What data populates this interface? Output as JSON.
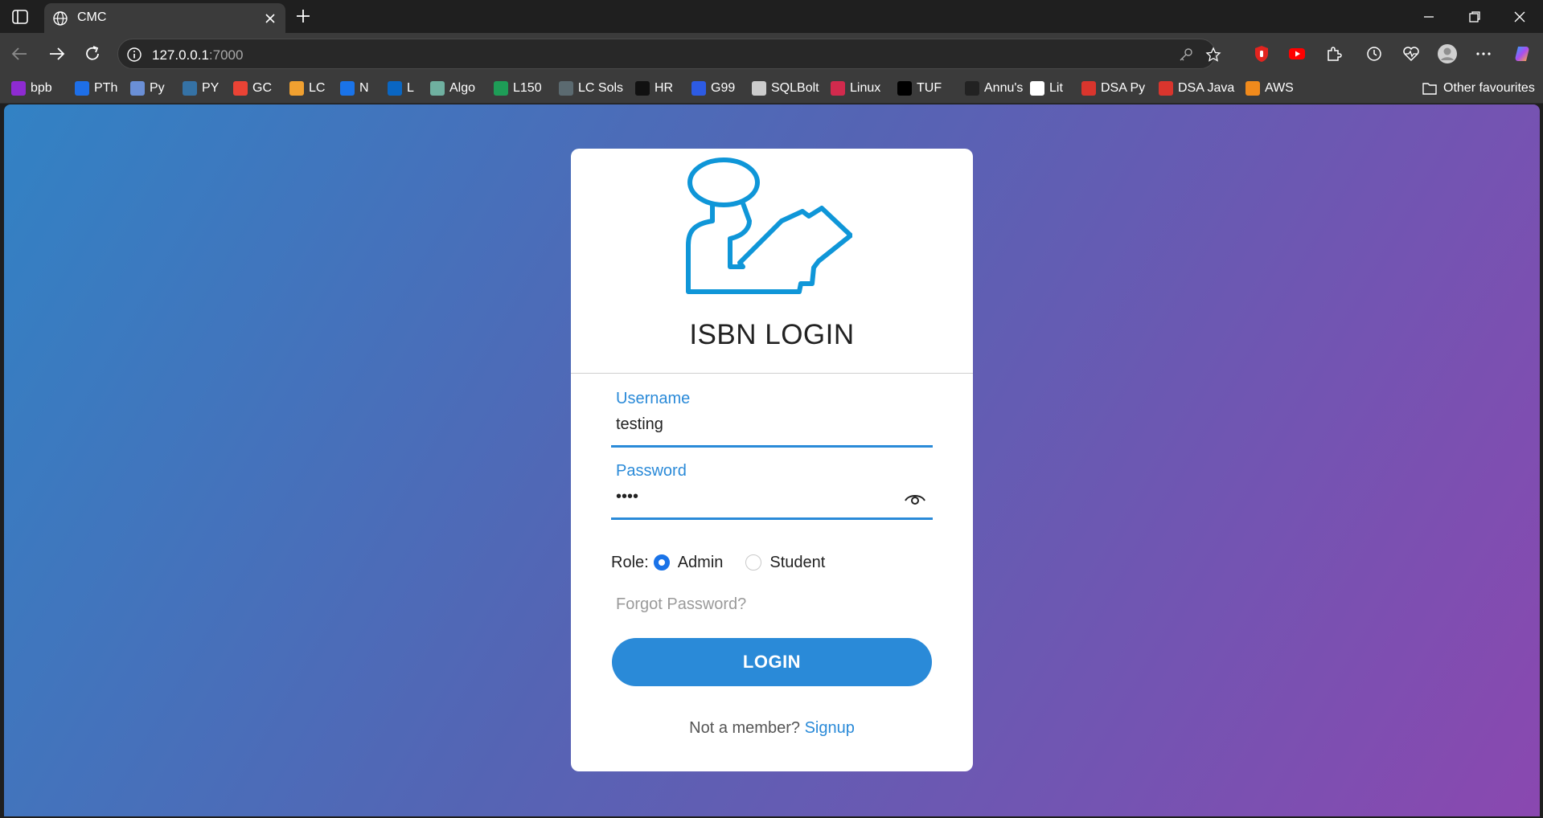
{
  "browser": {
    "tab_title": "CMC",
    "url_host": "127.0.0.1",
    "url_port": ":7000",
    "bookmarks": [
      {
        "label": "bpb",
        "icon": "bpb-icon",
        "color": "#8e2bd1"
      },
      {
        "label": "PTh",
        "icon": "b-icon",
        "color": "#1e6fe8"
      },
      {
        "label": "Py",
        "icon": "gears-icon",
        "color": "#6a8fd6"
      },
      {
        "label": "PY",
        "icon": "python-icon",
        "color": "#3572a5"
      },
      {
        "label": "GC",
        "icon": "google-icon",
        "color": "#ea4335"
      },
      {
        "label": "LC",
        "icon": "leetcode-icon",
        "color": "#f0a030"
      },
      {
        "label": "N",
        "icon": "n-icon",
        "color": "#1a73e8"
      },
      {
        "label": "L",
        "icon": "linkedin-icon",
        "color": "#0a66c2"
      },
      {
        "label": "Algo",
        "icon": "algo-icon",
        "color": "#6fb0a0"
      },
      {
        "label": "L150",
        "icon": "sheet-icon",
        "color": "#1e9d57"
      },
      {
        "label": "LC Sols",
        "icon": "w-icon",
        "color": "#5b6a70"
      },
      {
        "label": "HR",
        "icon": "hackerrank-icon",
        "color": "#111111"
      },
      {
        "label": "G99",
        "icon": "globe-blue-icon",
        "color": "#2d5be3"
      },
      {
        "label": "SQLBolt",
        "icon": "database-icon",
        "color": "#cccccc"
      },
      {
        "label": "Linux",
        "icon": "linux-icon",
        "color": "#d22a4d"
      },
      {
        "label": "TUF",
        "icon": "tuf-icon",
        "color": "#000000"
      },
      {
        "label": "Annu's",
        "icon": "butterfly-icon",
        "color": "#222222"
      },
      {
        "label": "Lit",
        "icon": "lit-icon",
        "color": "#ffffff"
      },
      {
        "label": "DSA Py",
        "icon": "pdf-icon",
        "color": "#d9352d"
      },
      {
        "label": "DSA Java",
        "icon": "pdf-icon",
        "color": "#d9352d"
      },
      {
        "label": "AWS",
        "icon": "aws-icon",
        "color": "#f08a1c"
      }
    ],
    "other_favourites": "Other favourites"
  },
  "login": {
    "title": "ISBN LOGIN",
    "username_label": "Username",
    "username_value": "testing",
    "password_label": "Password",
    "password_value": "test",
    "role_label": "Role:",
    "roles": [
      "Admin",
      "Student"
    ],
    "selected_role": "Admin",
    "forgot": "Forgot Password?",
    "login_button": "LOGIN",
    "not_member": "Not a member?",
    "signup": "Signup"
  },
  "colors": {
    "accent": "#2a8ad8",
    "gradient_start": "#3282c4",
    "gradient_end": "#8a48b0"
  }
}
